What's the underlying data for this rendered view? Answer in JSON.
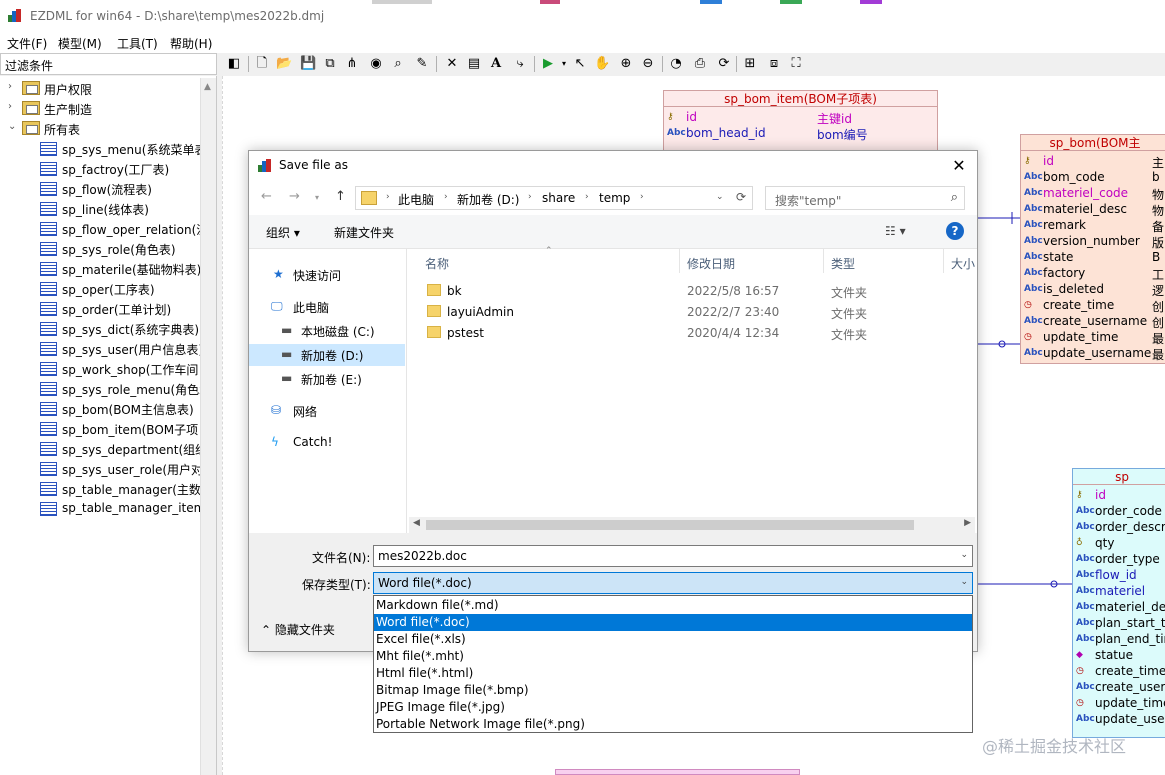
{
  "window": {
    "title": "EZDML for win64 - D:\\share\\temp\\mes2022b.dmj",
    "menu": [
      "文件(F)",
      "模型(M)",
      "工具(T)",
      "帮助(H)"
    ]
  },
  "left_panel": {
    "filter_label": "过滤条件",
    "folders": [
      "用户权限",
      "生产制造",
      "所有表"
    ],
    "tables": [
      "sp_sys_menu(系统菜单表",
      "sp_factroy(工厂表)",
      "sp_flow(流程表)",
      "sp_line(线体表)",
      "sp_flow_oper_relation(流",
      "sp_sys_role(角色表)",
      "sp_materile(基础物料表)",
      "sp_oper(工序表)",
      "sp_order(工单计划)",
      "sp_sys_dict(系统字典表)",
      "sp_sys_user(用户信息表)",
      "sp_work_shop(工作车间",
      "sp_sys_role_menu(角色x",
      "sp_bom(BOM主信息表)",
      "sp_bom_item(BOM子项",
      "sp_sys_department(组织",
      "sp_sys_user_role(用户对",
      "sp_table_manager(主数",
      "sp_table_manager_item"
    ]
  },
  "canvas": {
    "entity_bom_item": {
      "title": "sp_bom_item(BOM子项表)",
      "fields": [
        {
          "name": "id",
          "comment": "主键id"
        },
        {
          "name": "bom_head_id",
          "comment": "bom编号"
        }
      ]
    },
    "entity_bom": {
      "title": "sp_bom(BOM主",
      "fields": [
        "id",
        "bom_code",
        "materiel_code",
        "materiel_desc",
        "remark",
        "version_number",
        "state",
        "factory",
        "is_deleted",
        "create_time",
        "create_username",
        "update_time",
        "update_username"
      ],
      "comments": [
        "主",
        "b",
        "物",
        "物",
        "备",
        "版",
        "B",
        "工",
        "逻",
        "创",
        "创",
        "最",
        "最"
      ]
    },
    "entity_order": {
      "title": "sp",
      "fields": [
        "id",
        "order_code",
        "order_descri",
        "qty",
        "order_type",
        "flow_id",
        "materiel",
        "materiel_des",
        "plan_start_tin",
        "plan_end_tim",
        "statue",
        "create_time",
        "create_usern",
        "update_time",
        "update_user"
      ]
    }
  },
  "dialog": {
    "title": "Save file as",
    "breadcrumb": [
      "此电脑",
      "新加卷 (D:)",
      "share",
      "temp"
    ],
    "search_placeholder": "搜索\"temp\"",
    "cmd_organize": "组织 ▾",
    "cmd_new_folder": "新建文件夹",
    "nav": {
      "quick_access": "快速访问",
      "this_pc": "此电脑",
      "local_c": "本地磁盘 (C:)",
      "vol_d": "新加卷 (D:)",
      "vol_e": "新加卷 (E:)",
      "network": "网络",
      "catch": "Catch!"
    },
    "columns": [
      "名称",
      "修改日期",
      "类型",
      "大小"
    ],
    "files": [
      {
        "name": "bk",
        "date": "2022/5/8 16:57",
        "type": "文件夹"
      },
      {
        "name": "layuiAdmin",
        "date": "2022/2/7 23:40",
        "type": "文件夹"
      },
      {
        "name": "pstest",
        "date": "2020/4/4 12:34",
        "type": "文件夹"
      }
    ],
    "filename_label": "文件名(N):",
    "filename_value": "mes2022b.doc",
    "filetype_label": "保存类型(T):",
    "filetype_value": "Word file(*.doc)",
    "hide_folders": "隐藏文件夹",
    "filetype_options": [
      "Markdown file(*.md)",
      "Word file(*.doc)",
      "Excel file(*.xls)",
      "Mht file(*.mht)",
      "Html file(*.html)",
      "Bitmap Image file(*.bmp)",
      "JPEG Image file(*.jpg)",
      "Portable Network Image file(*.png)"
    ],
    "selected_option_index": 1
  },
  "watermark": "@稀土掘金技术社区",
  "colors": {
    "selection": "#0078d7",
    "nav_selected": "#cce8ff",
    "entity_pink": "#fdeaea",
    "entity_peach": "#fde3d6",
    "entity_cyan": "#dcfbfb",
    "entity_title": "#c00000"
  }
}
